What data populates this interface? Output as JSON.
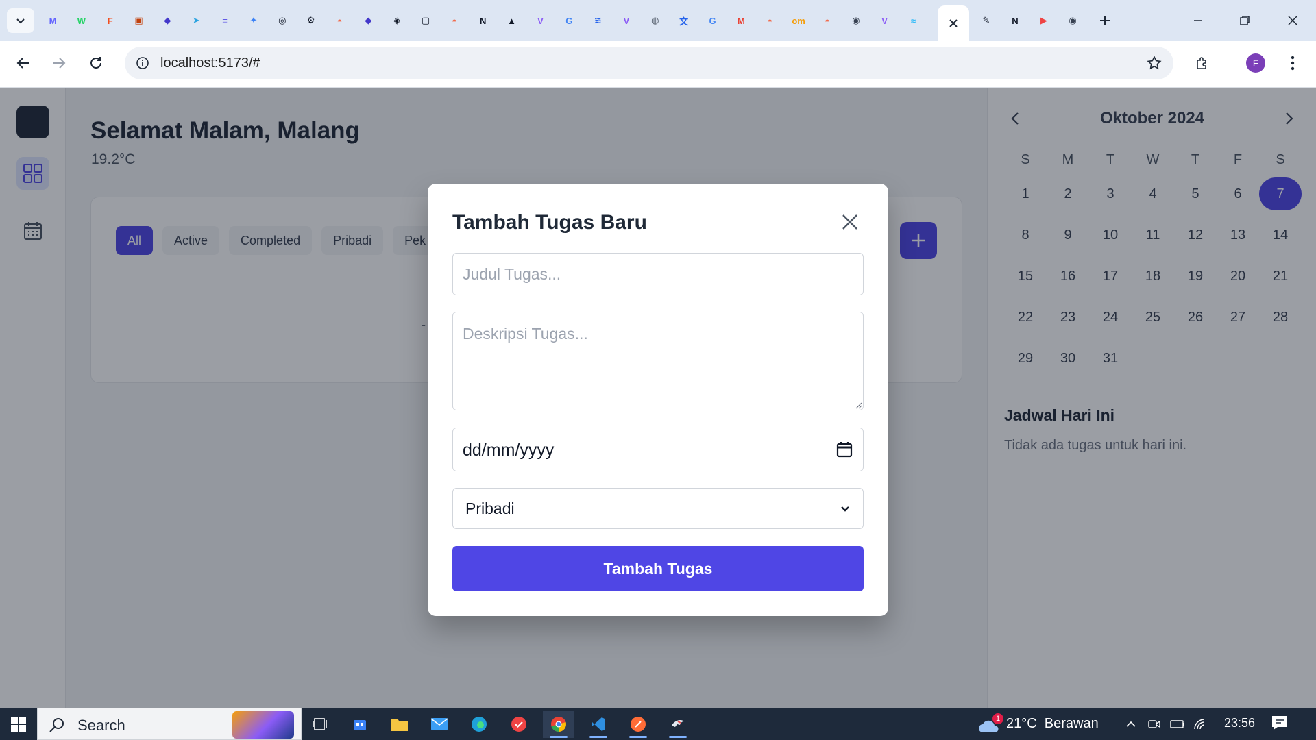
{
  "browser": {
    "url": "localhost:5173/#",
    "profile_initial": "F",
    "tab_favicons": [
      "mastodon",
      "whatsapp",
      "figma",
      "app",
      "kite",
      "telegram",
      "list",
      "gemini",
      "github",
      "openai",
      "duck",
      "kite",
      "git",
      "square",
      "duck",
      "notion",
      "atlas",
      "vuetify",
      "google",
      "stack",
      "vuetify",
      "globe",
      "translate",
      "google",
      "gmail",
      "duck",
      "om",
      "duck",
      "chrome",
      "vuetify",
      "tailwind"
    ],
    "tab_favicons_after": [
      "claude",
      "notion",
      "youtube",
      "chrome"
    ]
  },
  "header": {
    "greeting": "Selamat Malam, Malang",
    "temperature": "19.2°C"
  },
  "filters": [
    {
      "label": "All",
      "active": true
    },
    {
      "label": "Active",
      "active": false
    },
    {
      "label": "Completed",
      "active": false
    },
    {
      "label": "Pribadi",
      "active": false
    },
    {
      "label": "Pek",
      "active": false
    }
  ],
  "tasks_empty_marker": "-",
  "calendar": {
    "month_label": "Oktober 2024",
    "weekdays": [
      "S",
      "M",
      "T",
      "W",
      "T",
      "F",
      "S"
    ],
    "leading_blanks": 0,
    "days": [
      1,
      2,
      3,
      4,
      5,
      6,
      7,
      8,
      9,
      10,
      11,
      12,
      13,
      14,
      15,
      16,
      17,
      18,
      19,
      20,
      21,
      22,
      23,
      24,
      25,
      26,
      27,
      28,
      29,
      30,
      31
    ],
    "today": 7
  },
  "schedule": {
    "title": "Jadwal Hari Ini",
    "empty_text": "Tidak ada tugas untuk hari ini."
  },
  "modal": {
    "title": "Tambah Tugas Baru",
    "title_placeholder": "Judul Tugas...",
    "desc_placeholder": "Deskripsi Tugas...",
    "date_placeholder": "dd/mm/yyyy",
    "category_value": "Pribadi",
    "submit_label": "Tambah Tugas"
  },
  "taskbar": {
    "search_placeholder": "Search",
    "weather": "21°C  Berawan",
    "weather_badge": "1",
    "time": "23:56"
  },
  "colors": {
    "accent": "#4f46e5",
    "overlay": "rgba(17,24,39,0.42)"
  }
}
